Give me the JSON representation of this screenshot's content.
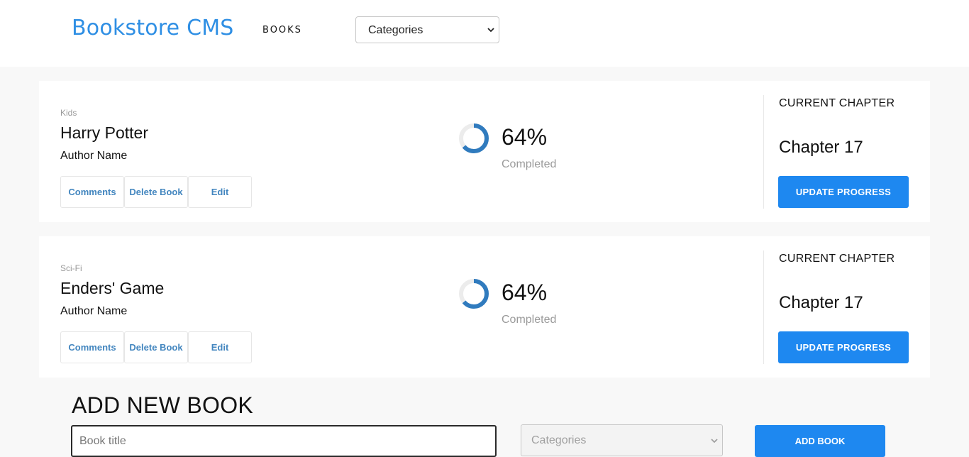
{
  "header": {
    "logo": "Bookstore CMS",
    "nav_books": "BOOKS",
    "category_filter": "Categories"
  },
  "books": [
    {
      "category": "Kids",
      "title": "Harry Potter",
      "author": "Author Name",
      "actions": {
        "comments": "Comments",
        "delete": "Delete Book",
        "edit": "Edit"
      },
      "progress": {
        "percent": 64,
        "percent_label": "64%",
        "status": "Completed"
      },
      "chapter": {
        "caption": "CURRENT CHAPTER",
        "name": "Chapter 17",
        "update_label": "UPDATE PROGRESS"
      }
    },
    {
      "category": "Sci-Fi",
      "title": "Enders' Game",
      "author": "Author Name",
      "actions": {
        "comments": "Comments",
        "delete": "Delete Book",
        "edit": "Edit"
      },
      "progress": {
        "percent": 64,
        "percent_label": "64%",
        "status": "Completed"
      },
      "chapter": {
        "caption": "CURRENT CHAPTER",
        "name": "Chapter 17",
        "update_label": "UPDATE PROGRESS"
      }
    }
  ],
  "add_form": {
    "title": "ADD NEW BOOK",
    "title_placeholder": "Book title",
    "category_placeholder": "Categories",
    "submit_label": "ADD BOOK"
  },
  "colors": {
    "brand": "#2f8fe4",
    "primary_button": "#1e88f0",
    "action_link": "#4386bf",
    "progress_ring": "#307bbe"
  }
}
